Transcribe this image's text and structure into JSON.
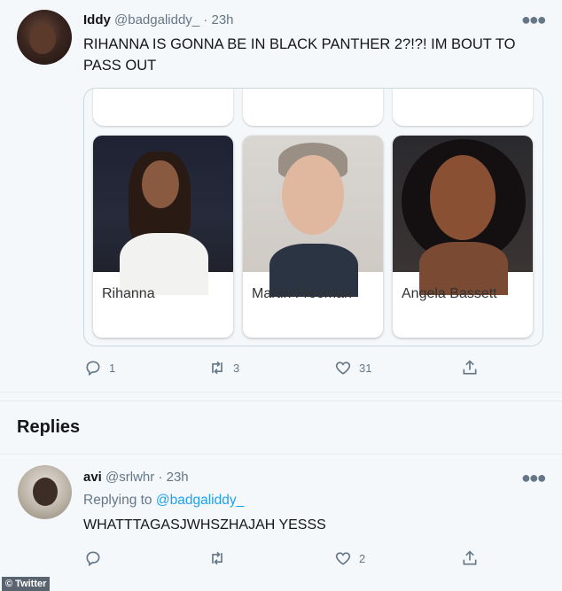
{
  "tweet": {
    "name": "Iddy",
    "handle": "@badgaliddy_",
    "time": "· 23h",
    "text": "RIHANNA IS GONNA BE IN BLACK PANTHER 2?!?! IM BOUT TO PASS OUT",
    "card": {
      "people": [
        "Rihanna",
        "Martin Freeman",
        "Angela Bassett"
      ]
    },
    "actions": {
      "replies": "1",
      "retweets": "3",
      "likes": "31"
    }
  },
  "replies_section": {
    "title": "Replies"
  },
  "reply": {
    "name": "avi",
    "handle": "@srlwhr",
    "time": "· 23h",
    "replying_prefix": "Replying to ",
    "replying_to": "@badgaliddy_",
    "text": "WHATTTAGASJWHSZHAJAH YESSS",
    "actions": {
      "likes": "2"
    }
  },
  "watermark": "© Twitter",
  "icons": {
    "more": "more-horizontal-icon",
    "reply": "reply-icon",
    "retweet": "retweet-icon",
    "like": "heart-icon",
    "share": "share-icon"
  },
  "colors": {
    "link": "#1da1f2",
    "muted": "#657786",
    "text": "#14171a"
  }
}
